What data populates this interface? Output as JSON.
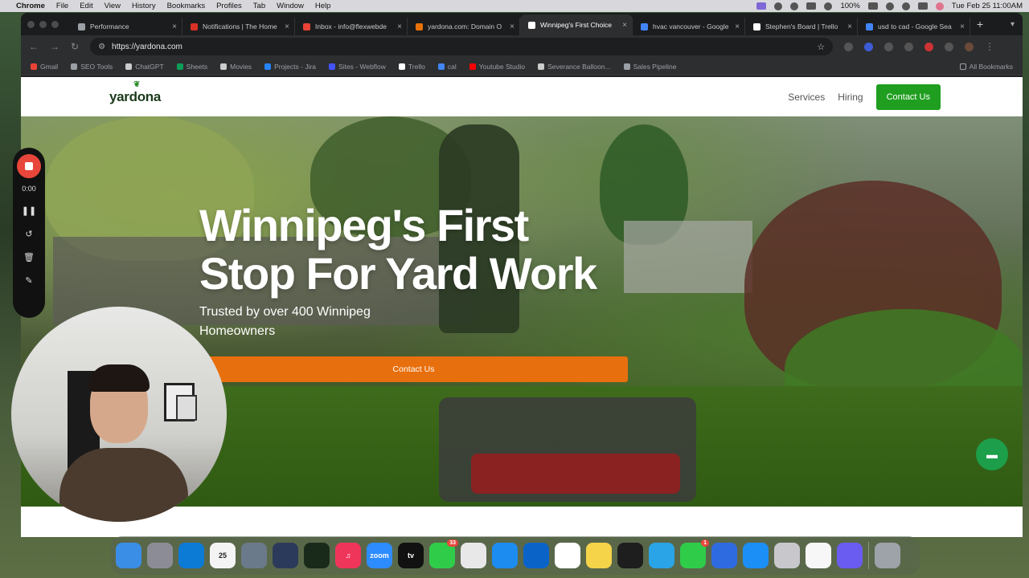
{
  "menubar": {
    "app_name": "Chrome",
    "items": [
      "File",
      "Edit",
      "View",
      "History",
      "Bookmarks",
      "Profiles",
      "Tab",
      "Window",
      "Help"
    ],
    "battery": "100%",
    "clock": "Tue Feb 25  11:00AM"
  },
  "tabs": [
    {
      "title": "Performance",
      "color": "#9aa0a6"
    },
    {
      "title": "Notifications | The Home",
      "color": "#d93025"
    },
    {
      "title": "Inbox - info@flexwebde",
      "color": "#ea4335"
    },
    {
      "title": "yardona.com: Domain O",
      "color": "#e8710a"
    },
    {
      "title": "Winnipeg's First Choice",
      "color": "#ffffff"
    },
    {
      "title": "hvac vancouver - Google",
      "color": "#4285f4"
    },
    {
      "title": "Stephen's Board | Trello",
      "color": "#ffffff"
    },
    {
      "title": "usd to cad - Google Sea",
      "color": "#4285f4"
    }
  ],
  "active_tab_index": 4,
  "url": "https://yardona.com",
  "bookmarks": [
    {
      "label": "Gmail",
      "color": "#ea4335"
    },
    {
      "label": "SEO Tools",
      "color": "#9aa0a6"
    },
    {
      "label": "ChatGPT",
      "color": "#cccccc"
    },
    {
      "label": "Sheets",
      "color": "#0f9d58"
    },
    {
      "label": "Movies",
      "color": "#cccccc"
    },
    {
      "label": "Projects - Jira",
      "color": "#2684ff"
    },
    {
      "label": "Sites - Webflow",
      "color": "#4353ff"
    },
    {
      "label": "Trello",
      "color": "#ffffff"
    },
    {
      "label": "cal",
      "color": "#4285f4"
    },
    {
      "label": "Youtube Studio",
      "color": "#ff0000"
    },
    {
      "label": "Severance Balloon...",
      "color": "#cccccc"
    },
    {
      "label": "Sales Pipeline",
      "color": "#9aa0a6"
    }
  ],
  "all_bookmarks": "All Bookmarks",
  "site": {
    "logo_text": "yardona",
    "nav": [
      "Services",
      "Hiring"
    ],
    "nav_cta": "Contact Us",
    "hero_title_line1": "Winnipeg's First",
    "hero_title_line2": "Stop For Yard Work",
    "hero_subtitle": "Trusted by over 400 Winnipeg Homeowners",
    "hero_cta": "Contact Us",
    "accent_green": "#1f9e1f",
    "accent_orange": "#e86f0d"
  },
  "recorder": {
    "time": "0:00"
  },
  "dock": [
    {
      "name": "finder",
      "color": "#3a8ee6",
      "label": ""
    },
    {
      "name": "launchpad",
      "color": "#8c8c96",
      "label": ""
    },
    {
      "name": "edge",
      "color": "#0c7bd6",
      "label": ""
    },
    {
      "name": "calendar",
      "color": "#f4f4f4",
      "label": "25"
    },
    {
      "name": "preview",
      "color": "#6b7a8a",
      "label": ""
    },
    {
      "name": "safari-alt",
      "color": "#2b3a5a",
      "label": ""
    },
    {
      "name": "activity-monitor",
      "color": "#1a2a1a",
      "label": ""
    },
    {
      "name": "music",
      "color": "#f0355a",
      "label": "♫"
    },
    {
      "name": "zoom",
      "color": "#2d8cff",
      "label": "zoom"
    },
    {
      "name": "apple-tv",
      "color": "#111111",
      "label": "tv"
    },
    {
      "name": "messages",
      "color": "#2fcc4a",
      "label": "",
      "badge": "33"
    },
    {
      "name": "chrome",
      "color": "#e8e8e8",
      "label": ""
    },
    {
      "name": "safari",
      "color": "#1c8cf0",
      "label": ""
    },
    {
      "name": "outlook",
      "color": "#0a64c8",
      "label": ""
    },
    {
      "name": "slack",
      "color": "#ffffff",
      "label": ""
    },
    {
      "name": "notes",
      "color": "#f5d44a",
      "label": ""
    },
    {
      "name": "figma",
      "color": "#1e1e1e",
      "label": ""
    },
    {
      "name": "screens",
      "color": "#2aa4e6",
      "label": ""
    },
    {
      "name": "facetime",
      "color": "#2fcc4a",
      "label": "",
      "badge": "1"
    },
    {
      "name": "docs",
      "color": "#2f6be0",
      "label": ""
    },
    {
      "name": "app-store",
      "color": "#1b8ff5",
      "label": ""
    },
    {
      "name": "iphone-mirroring",
      "color": "#c8c8cc",
      "label": ""
    },
    {
      "name": "photos",
      "color": "#f7f7f7",
      "label": ""
    },
    {
      "name": "perplexity",
      "color": "#6a5cf0",
      "label": ""
    },
    {
      "name": "trash",
      "color": "#9da3a9",
      "label": ""
    }
  ]
}
